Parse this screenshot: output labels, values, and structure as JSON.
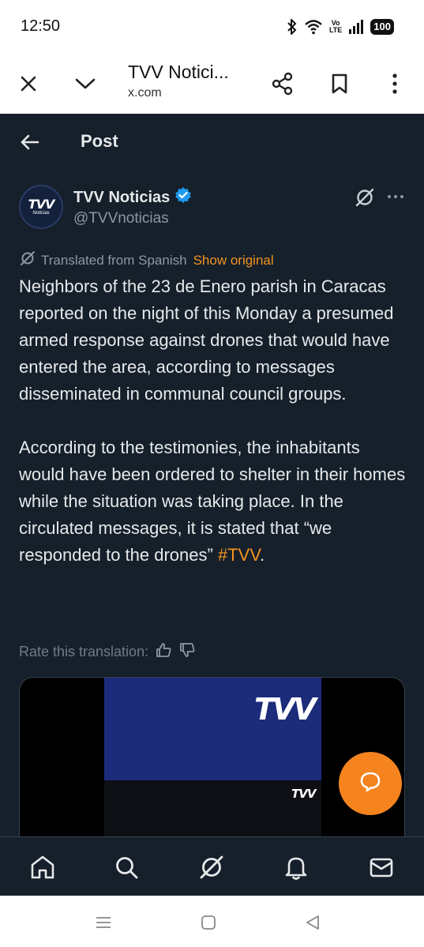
{
  "status": {
    "time": "12:50",
    "volte_top": "Vo",
    "volte_bottom": "LTE",
    "battery": "100"
  },
  "browser": {
    "title": "TVV Notici...",
    "url": "x.com"
  },
  "header": {
    "title": "Post"
  },
  "author": {
    "name": "TVV Noticias",
    "handle": "@TVVnoticias",
    "avatar_text": "TVV",
    "avatar_subtext": "Noticias"
  },
  "translation": {
    "label": "Translated from Spanish",
    "show_original": "Show original"
  },
  "post": {
    "paragraph1": "Neighbors of the 23 de Enero parish in Caracas reported on the night of this Monday a presumed armed response against drones that would have entered the area, according to messages disseminated in communal council groups.",
    "paragraph2": "According to the testimonies, the inhabitants would have been ordered to shelter in their homes while the situation was taking place. In the circulated messages, it is stated that “we responded to the drones”",
    "hashtag": "#TVV",
    "trailing": "."
  },
  "rate": {
    "label": "Rate this translation:"
  },
  "media": {
    "logo_large": "TVV",
    "logo_small": "TVV"
  },
  "colors": {
    "accent": "#f5931f",
    "background": "#15202b",
    "verified": "#1d9bf0",
    "fab": "#f5841f"
  },
  "tabs": [
    "home-icon",
    "search-icon",
    "grok-icon",
    "notifications-icon",
    "messages-icon"
  ]
}
